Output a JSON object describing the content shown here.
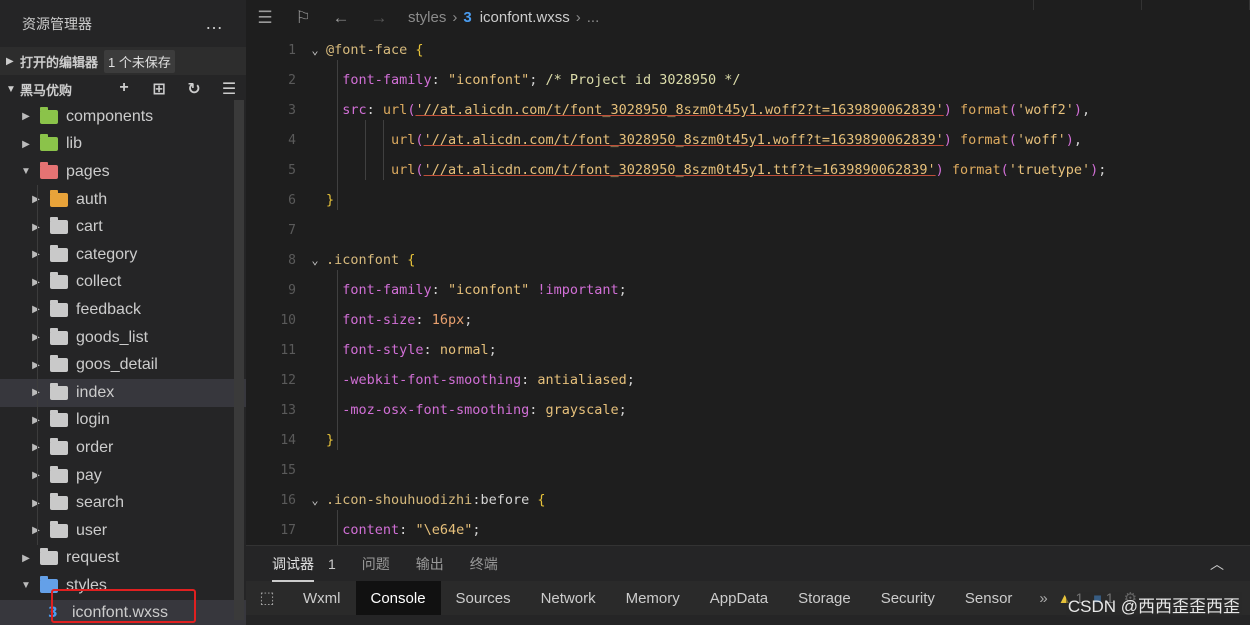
{
  "sidebar": {
    "title": "资源管理器",
    "more_icon": "…",
    "open_editors": {
      "label": "打开的编辑器",
      "badge": "1 个未保存"
    },
    "project": {
      "label": "黑马优购"
    },
    "tree": [
      {
        "label": "components",
        "icon": "folder-green"
      },
      {
        "label": "lib",
        "icon": "folder-green"
      },
      {
        "label": "pages",
        "icon": "folder-red"
      },
      {
        "label": "auth",
        "icon": "folder-orange"
      },
      {
        "label": "cart",
        "icon": "folder-grey"
      },
      {
        "label": "category",
        "icon": "folder-grey"
      },
      {
        "label": "collect",
        "icon": "folder-grey"
      },
      {
        "label": "feedback",
        "icon": "folder-grey"
      },
      {
        "label": "goods_list",
        "icon": "folder-grey"
      },
      {
        "label": "goos_detail",
        "icon": "folder-grey"
      },
      {
        "label": "index",
        "icon": "folder-grey"
      },
      {
        "label": "login",
        "icon": "folder-grey"
      },
      {
        "label": "order",
        "icon": "folder-grey"
      },
      {
        "label": "pay",
        "icon": "folder-grey"
      },
      {
        "label": "search",
        "icon": "folder-grey"
      },
      {
        "label": "user",
        "icon": "folder-grey"
      },
      {
        "label": "request",
        "icon": "folder-grey"
      },
      {
        "label": "styles",
        "icon": "folder-blue"
      },
      {
        "label": "iconfont.wxss",
        "icon": "css-file"
      }
    ]
  },
  "breadcrumb": {
    "folder": "styles",
    "file": "iconfont.wxss",
    "ellipsis": "..."
  },
  "code": {
    "line_numbers": [
      "1",
      "2",
      "3",
      "4",
      "5",
      "6",
      "7",
      "8",
      "9",
      "10",
      "11",
      "12",
      "13",
      "14",
      "15",
      "16",
      "17"
    ],
    "l1_sel": "@font-face",
    "l1_brace": "{",
    "l2_prop": "font-family",
    "l2_val": "\"iconfont\"",
    "l2_comment": "/* Project id 3028950 */",
    "l3_prop": "src",
    "l3_url": "'//at.alicdn.com/t/font_3028950_8szm0t45y1.woff2?t=1639890062839'",
    "l3_fmt": "'woff2'",
    "l4_url": "'//at.alicdn.com/t/font_3028950_8szm0t45y1.woff?t=1639890062839'",
    "l4_fmt": "'woff'",
    "l5_url": "'//at.alicdn.com/t/font_3028950_8szm0t45y1.ttf?t=1639890062839'",
    "l5_fmt": "'truetype'",
    "l6_brace": "}",
    "l8_sel": ".iconfont",
    "l8_brace": "{",
    "l9_prop": "font-family",
    "l9_val": "\"iconfont\"",
    "l9_imp": "!important",
    "l10_prop": "font-size",
    "l10_val": "16px",
    "l11_prop": "font-style",
    "l11_val": "normal",
    "l12_prop": "-webkit-font-smoothing",
    "l12_val": "antialiased",
    "l13_prop": "-moz-osx-font-smoothing",
    "l13_val": "grayscale",
    "l14_brace": "}",
    "l16_sel": ".icon-shouhuodizhi",
    "l16_pseudo": ":before",
    "l16_brace": "{",
    "l17_prop": "content",
    "l17_val": "\"\\e64e\"",
    "fn_url": "url",
    "fn_format": "format"
  },
  "panel": {
    "tabs": [
      "调试器",
      "1",
      "问题",
      "输出",
      "终端"
    ],
    "devtools": [
      "Wxml",
      "Console",
      "Sources",
      "Network",
      "Memory",
      "AppData",
      "Storage",
      "Security",
      "Sensor"
    ],
    "warn_count": "1",
    "err_count": "1"
  },
  "watermark": "CSDN @西西歪歪西歪"
}
